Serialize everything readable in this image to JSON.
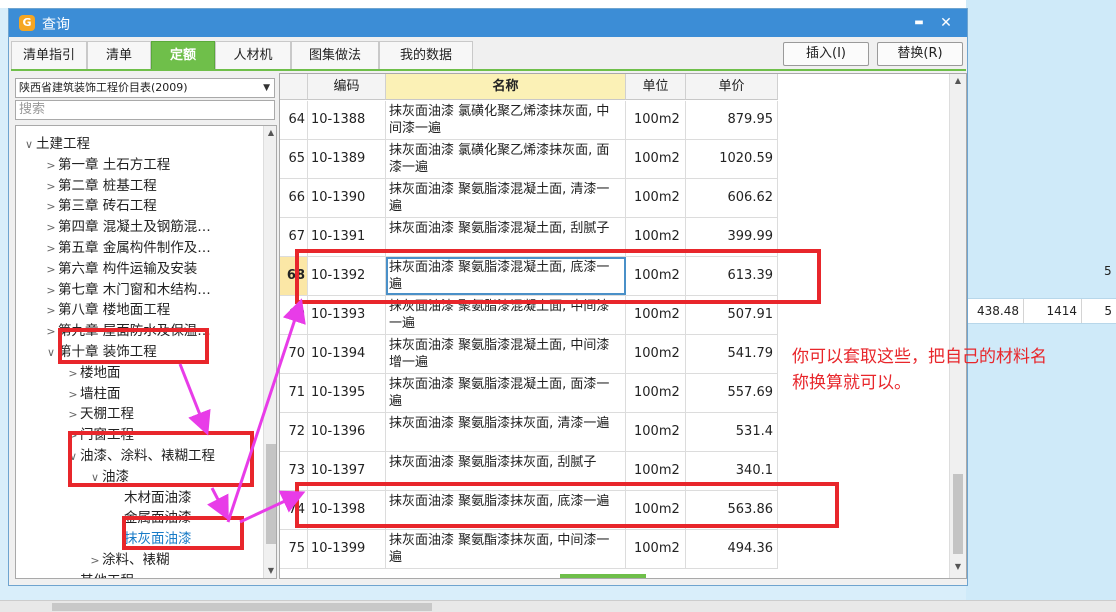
{
  "window": {
    "title": "查询",
    "minimize_label": "▬",
    "close_label": "✕"
  },
  "tabs": [
    "清单指引",
    "清单",
    "定额",
    "人材机",
    "图集做法",
    "我的数据"
  ],
  "active_tab": "定额",
  "buttons": {
    "insert": "插入(I)",
    "replace": "替换(R)"
  },
  "combo_value": "陕西省建筑装饰工程价目表(2009)",
  "search_placeholder": "搜索",
  "tree": [
    {
      "label": "土建工程",
      "caret": "∨"
    },
    {
      "label": "第一章 土石方工程",
      "caret": ">"
    },
    {
      "label": "第二章 桩基工程",
      "caret": ">"
    },
    {
      "label": "第三章 砖石工程",
      "caret": ">"
    },
    {
      "label": "第四章 混凝土及钢筋混…",
      "caret": ">"
    },
    {
      "label": "第五章 金属构件制作及…",
      "caret": ">"
    },
    {
      "label": "第六章 构件运输及安装",
      "caret": ">"
    },
    {
      "label": "第七章 木门窗和木结构…",
      "caret": ">"
    },
    {
      "label": "第八章 楼地面工程",
      "caret": ">"
    },
    {
      "label": "第九章 屋面防水及保温…",
      "caret": ">"
    },
    {
      "label": "第十章 装饰工程",
      "caret": "∨"
    },
    {
      "label": "楼地面",
      "caret": ">"
    },
    {
      "label": "墙柱面",
      "caret": ">"
    },
    {
      "label": "天棚工程",
      "caret": ">"
    },
    {
      "label": "门窗工程",
      "caret": ">"
    },
    {
      "label": "油漆、涂料、裱糊工程",
      "caret": "∨"
    },
    {
      "label": "油漆",
      "caret": "∨"
    },
    {
      "label": "木材面油漆",
      "caret": ""
    },
    {
      "label": "金属面油漆",
      "caret": ""
    },
    {
      "label": "抹灰面油漆",
      "caret": ""
    },
    {
      "label": "涂料、裱糊",
      "caret": ">"
    },
    {
      "label": "其他工程",
      "caret": ">"
    }
  ],
  "table": {
    "headers": {
      "code": "编码",
      "name": "名称",
      "unit": "单位",
      "price": "单价"
    },
    "rows": [
      {
        "idx": "64",
        "code": "10-1388",
        "name": "抹灰面油漆 氯磺化聚乙烯漆抹灰面, 中间漆一遍",
        "unit": "100m2",
        "price": "879.95"
      },
      {
        "idx": "65",
        "code": "10-1389",
        "name": "抹灰面油漆 氯磺化聚乙烯漆抹灰面, 面漆一遍",
        "unit": "100m2",
        "price": "1020.59"
      },
      {
        "idx": "66",
        "code": "10-1390",
        "name": "抹灰面油漆 聚氨脂漆混凝土面, 清漆一遍",
        "unit": "100m2",
        "price": "606.62"
      },
      {
        "idx": "67",
        "code": "10-1391",
        "name": "抹灰面油漆 聚氨脂漆混凝土面, 刮腻子",
        "unit": "100m2",
        "price": "399.99"
      },
      {
        "idx": "68",
        "code": "10-1392",
        "name": "抹灰面油漆 聚氨脂漆混凝土面, 底漆一遍",
        "unit": "100m2",
        "price": "613.39"
      },
      {
        "idx": "69",
        "code": "10-1393",
        "name": "抹灰面油漆 聚氨脂漆混凝土面, 中间漆一遍",
        "unit": "100m2",
        "price": "507.91"
      },
      {
        "idx": "70",
        "code": "10-1394",
        "name": "抹灰面油漆 聚氨脂漆混凝土面, 中间漆增一遍",
        "unit": "100m2",
        "price": "541.79"
      },
      {
        "idx": "71",
        "code": "10-1395",
        "name": "抹灰面油漆 聚氨脂漆混凝土面, 面漆一遍",
        "unit": "100m2",
        "price": "557.69"
      },
      {
        "idx": "72",
        "code": "10-1396",
        "name": "抹灰面油漆 聚氨脂漆抹灰面, 清漆一遍",
        "unit": "100m2",
        "price": "531.4"
      },
      {
        "idx": "73",
        "code": "10-1397",
        "name": "抹灰面油漆 聚氨脂漆抹灰面, 刮腻子",
        "unit": "100m2",
        "price": "340.1"
      },
      {
        "idx": "74",
        "code": "10-1398",
        "name": "抹灰面油漆 聚氨脂漆抹灰面, 底漆一遍",
        "unit": "100m2",
        "price": "563.86"
      },
      {
        "idx": "75",
        "code": "10-1399",
        "name": "抹灰面油漆 聚氨酯漆抹灰面, 中间漆一遍",
        "unit": "100m2",
        "price": "494.36"
      }
    ]
  },
  "annotation": "你可以套取这些，把自己的材料名称换算就可以。",
  "background_cells": {
    "a": "438.48",
    "b": "1414",
    "c": "5",
    "d": "5"
  },
  "colors": {
    "title_bar": "#3c8dd6",
    "active_tab": "#6fbf4a",
    "highlight_box": "#e8262b",
    "arrow": "#e83ce8"
  }
}
